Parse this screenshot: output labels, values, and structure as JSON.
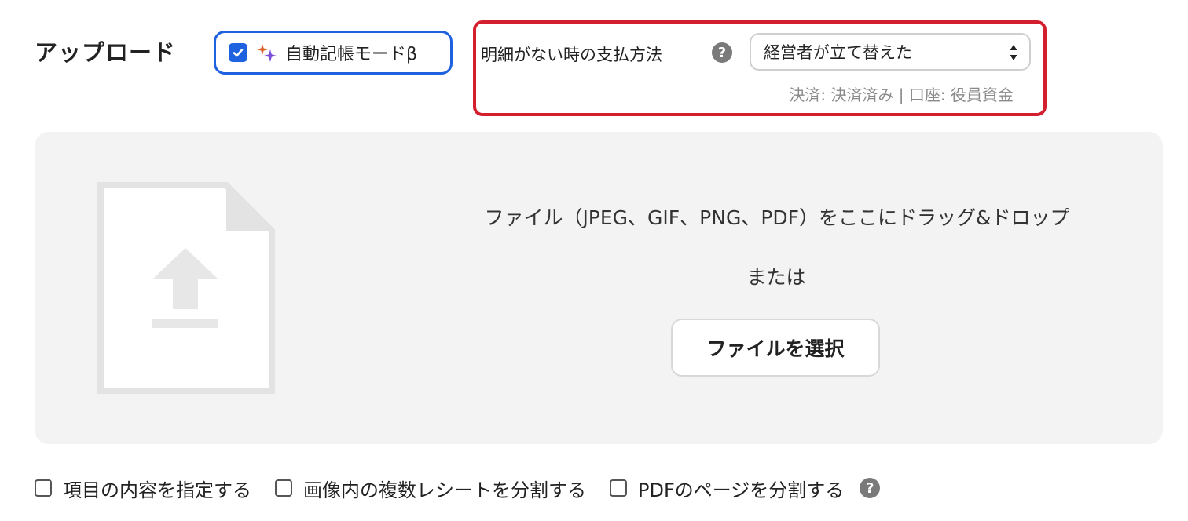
{
  "upload": {
    "title": "アップロード"
  },
  "auto_mode": {
    "checked": true,
    "label": "自動記帳モードβ"
  },
  "payment": {
    "label": "明細がない時の支払方法",
    "help_icon": "question-circle-icon",
    "selected": "経営者が立て替えた",
    "detail": "決済: 決済済み | 口座: 役員資金"
  },
  "dropzone": {
    "instruction": "ファイル（JPEG、GIF、PNG、PDF）をここにドラッグ&ドロップ",
    "or_text": "または",
    "button_label": "ファイルを選択"
  },
  "options": {
    "specify_items_label": "項目の内容を指定する",
    "split_receipts_label": "画像内の複数レシートを分割する",
    "split_pdf_label": "PDFのページを分割する",
    "help_icon": "question-circle-icon"
  },
  "colors": {
    "accent_blue": "#1f62e0",
    "highlight_red": "#d4202e",
    "dropzone_bg": "#f4f3f4"
  }
}
